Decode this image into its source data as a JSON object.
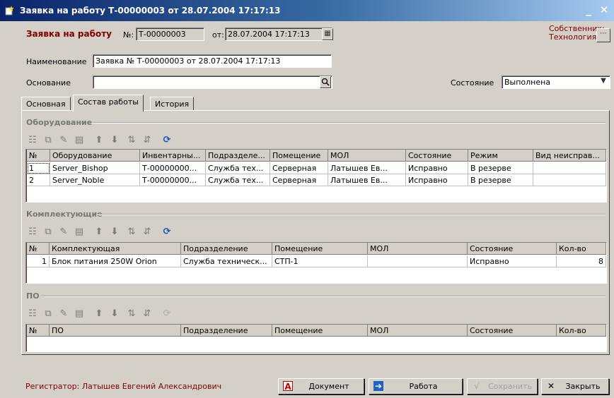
{
  "window": {
    "title": "Заявка на работу Т-00000003   от 28.07.2004 17:17:13",
    "minimize": "_",
    "close": "✕"
  },
  "header": {
    "doc_label": "Заявка на работу",
    "number_label": "№:",
    "number_value": "Т-00000003",
    "date_label": "от:",
    "date_value": "28.07.2004 17:17:13",
    "owner_label": "Собственник:",
    "owner_value": "Технология",
    "name_label": "Наименование",
    "name_value": "Заявка № Т-00000003 от 28.07.2004 17:17:13",
    "basis_label": "Основание",
    "basis_value": "",
    "state_label": "Состояние",
    "state_value": "Выполнена"
  },
  "tabs": [
    {
      "label": "Основная"
    },
    {
      "label": "Состав работы"
    },
    {
      "label": "История"
    }
  ],
  "equipment": {
    "title": "Оборудование",
    "columns": [
      "№",
      "Оборудование",
      "Инвентарны...",
      "Подразделе...",
      "Помещение",
      "МОЛ",
      "Состояние",
      "Режим",
      "Вид неисправ..."
    ],
    "rows": [
      [
        "1",
        "Server_Bishop",
        "Т-00000000...",
        "Служба тех...",
        "Серверная",
        "Латышев Ев...",
        "Исправно",
        "В резерве",
        ""
      ],
      [
        "2",
        "Server_Noble",
        "Т-00000000...",
        "Служба тех...",
        "Серверная",
        "Латышев Ев...",
        "Исправно",
        "В резерве",
        ""
      ]
    ]
  },
  "components": {
    "title": "Комплектующие",
    "columns": [
      "№",
      "Комплектующая",
      "Подразделение",
      "Помещение",
      "МОЛ",
      "Состояние",
      "Кол-во"
    ],
    "rows": [
      [
        "1",
        "Блок питания 250W Orion",
        "Служба техническ...",
        "СТП-1",
        "",
        "Исправно",
        "8"
      ]
    ]
  },
  "software": {
    "title": "ПО",
    "columns": [
      "№",
      "ПО",
      "Подразделение",
      "Помещение",
      "МОЛ",
      "Состояние",
      "Кол-во"
    ],
    "rows": []
  },
  "footer": {
    "registrar": "Регистратор: Латышев Евгений Александрович",
    "btn_document": "Документ",
    "btn_work": "Работа",
    "btn_save": "Сохранить",
    "btn_close": "Закрыть"
  }
}
